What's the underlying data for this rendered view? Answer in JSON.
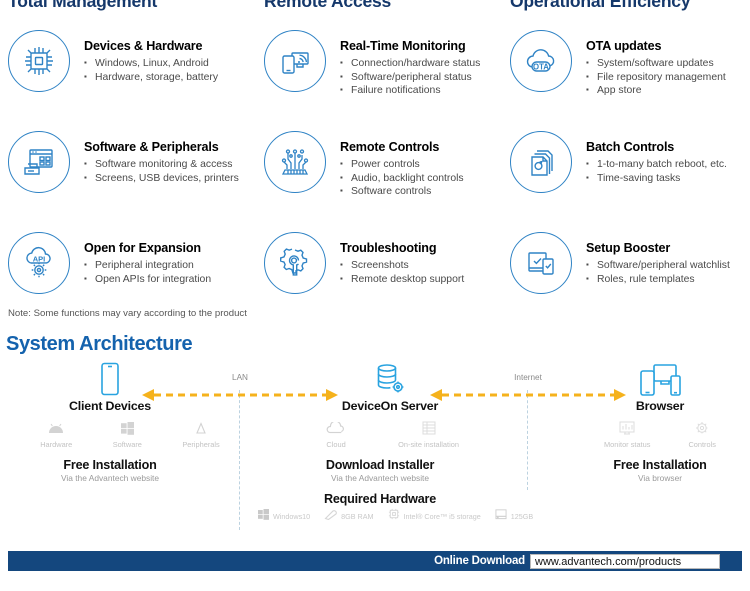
{
  "columns": [
    {
      "title": "Total Management",
      "items": [
        {
          "icon": "chip-icon",
          "title": "Devices & Hardware",
          "bullets": [
            "Windows, Linux, Android",
            "Hardware, storage, battery"
          ]
        },
        {
          "icon": "software-peripherals-icon",
          "title": "Software & Peripherals",
          "bullets": [
            "Software monitoring & access",
            "Screens, USB devices, printers"
          ]
        },
        {
          "icon": "api-cloud-gear-icon",
          "title": "Open for Expansion",
          "bullets": [
            "Peripheral integration",
            "Open APIs for integration"
          ]
        }
      ]
    },
    {
      "title": "Remote Access",
      "items": [
        {
          "icon": "monitor-phone-signal-icon",
          "title": "Real-Time Monitoring",
          "bullets": [
            "Connection/hardware status",
            "Software/peripheral status",
            "Failure notifications"
          ]
        },
        {
          "icon": "circuit-board-icon",
          "title": "Remote Controls",
          "bullets": [
            "Power controls",
            "Audio, backlight controls",
            "Software controls"
          ]
        },
        {
          "icon": "gear-wrench-icon",
          "title": "Troubleshooting",
          "bullets": [
            "Screenshots",
            "Remote desktop support"
          ]
        }
      ]
    },
    {
      "title": "Operational Efficiency",
      "items": [
        {
          "icon": "ota-cloud-icon",
          "title": "OTA updates",
          "bullets": [
            "System/software updates",
            "File repository management",
            "App store"
          ]
        },
        {
          "icon": "stacked-documents-icon",
          "title": "Batch Controls",
          "bullets": [
            "1-to-many batch reboot, etc.",
            "Time-saving tasks"
          ]
        },
        {
          "icon": "checklist-devices-icon",
          "title": "Setup Booster",
          "bullets": [
            "Software/peripheral watchlist",
            "Roles, rule templates"
          ]
        }
      ]
    }
  ],
  "note": "Note: Some functions may vary according to the product",
  "architecture": {
    "title": "System Architecture",
    "nodes": [
      {
        "icon": "tablet-device-icon",
        "label": "Client Devices"
      },
      {
        "icon": "database-gear-icon",
        "label": "DeviceOn Server"
      },
      {
        "icon": "multi-device-browser-icon",
        "label": "Browser"
      }
    ],
    "links": [
      {
        "label": "LAN"
      },
      {
        "label": "Internet"
      }
    ],
    "client_subicons": [
      {
        "icon": "android-icon",
        "label": "Hardware"
      },
      {
        "icon": "windows-icon",
        "label": "Software"
      },
      {
        "icon": "peripherals-icon",
        "label": "Peripherals"
      }
    ],
    "server_subicons": [
      {
        "icon": "cloud-icon",
        "label": "Cloud"
      },
      {
        "icon": "onsite-server-icon",
        "label": "On-site installation"
      }
    ],
    "browser_subicons": [
      {
        "icon": "monitor-status-icon",
        "label": "Monitor status"
      },
      {
        "icon": "controls-gear-icon",
        "label": "Controls"
      }
    ],
    "captions": [
      {
        "heading": "Free Installation",
        "sub": "Via the Advantech website"
      },
      {
        "heading": "Download Installer",
        "sub": "Via the Advantech website"
      },
      {
        "heading": "Free Installation",
        "sub": "Via browser"
      }
    ],
    "required_hardware_heading": "Required Hardware",
    "required_hardware": [
      {
        "icon": "windows-icon",
        "label": "Windows10"
      },
      {
        "icon": "ram-stick-icon",
        "label": "8GB RAM"
      },
      {
        "icon": "cpu-icon",
        "label": "Intel® Core™ i5 storage"
      },
      {
        "icon": "hdd-icon",
        "label": "125GB"
      }
    ]
  },
  "footer": {
    "label": "Online Download",
    "url": "www.advantech.com/products"
  },
  "colors": {
    "accent_blue": "#2f83c5",
    "title_navy": "#15386b",
    "heading_blue": "#1462ad",
    "arrow_yellow": "#f5b21c",
    "footer_navy": "#14477e"
  }
}
